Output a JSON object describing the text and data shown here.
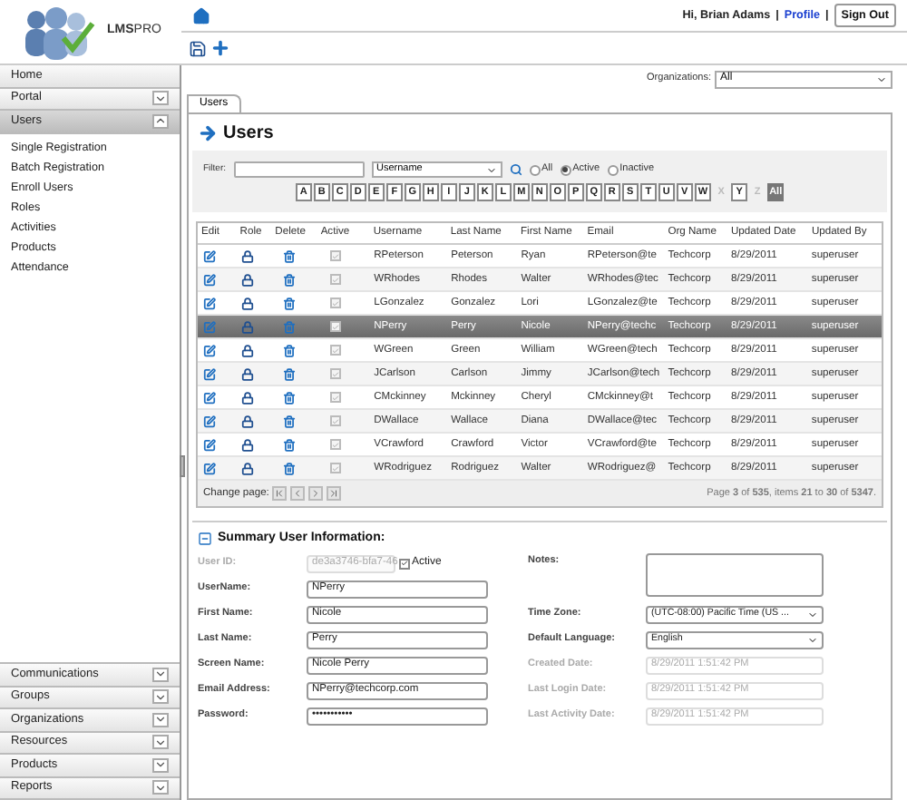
{
  "header": {
    "logo_text": "**LMS**PRO",
    "user_links": [
      {
        "kind": "text",
        "text": "Hi, Brian Adams"
      },
      {
        "kind": "sep",
        "text": "|"
      },
      {
        "kind": "link",
        "text": "Profile"
      },
      {
        "kind": "sep",
        "text": "|"
      },
      {
        "kind": "button",
        "text": "Sign Out"
      }
    ]
  },
  "sidebar": [
    {
      "label": "Home",
      "kind": "link"
    },
    {
      "label": "Portal",
      "kind": "group",
      "expanded": false
    },
    {
      "label": "Users",
      "kind": "group",
      "expanded": true,
      "children": [
        {
          "label": "Single Registration"
        },
        {
          "label": "Batch Registration"
        },
        {
          "label": "Enroll Users"
        },
        {
          "label": "Roles"
        },
        {
          "label": "Activities"
        },
        {
          "label": "Products"
        },
        {
          "label": "Attendance"
        }
      ]
    },
    {
      "label": "Communications",
      "kind": "group",
      "expanded": false
    },
    {
      "label": "Groups",
      "kind": "group",
      "expanded": false
    },
    {
      "label": "Organizations",
      "kind": "group",
      "expanded": false
    },
    {
      "label": "Resources",
      "kind": "group",
      "expanded": false
    },
    {
      "label": "Products",
      "kind": "group",
      "expanded": false
    },
    {
      "label": "Reports",
      "kind": "group",
      "expanded": false
    }
  ],
  "organizations": {
    "label": "Organizations:",
    "value": "All"
  },
  "tabs": [
    {
      "label": "Users",
      "selected": true
    }
  ],
  "page_title": "Users",
  "filter": {
    "label": "Filter:",
    "field_select": "Username",
    "radios": [
      {
        "label": "All",
        "selected": false
      },
      {
        "label": "Active",
        "selected": true
      },
      {
        "label": "Inactive",
        "selected": false
      }
    ],
    "letters": [
      {
        "label": "A",
        "disabled": false,
        "selected": false
      },
      {
        "label": "B",
        "disabled": false,
        "selected": false
      },
      {
        "label": "C",
        "disabled": false,
        "selected": false
      },
      {
        "label": "D",
        "disabled": false,
        "selected": false
      },
      {
        "label": "E",
        "disabled": false,
        "selected": false
      },
      {
        "label": "F",
        "disabled": false,
        "selected": false
      },
      {
        "label": "G",
        "disabled": false,
        "selected": false
      },
      {
        "label": "H",
        "disabled": false,
        "selected": false
      },
      {
        "label": "I",
        "disabled": false,
        "selected": false
      },
      {
        "label": "J",
        "disabled": false,
        "selected": false
      },
      {
        "label": "K",
        "disabled": false,
        "selected": false
      },
      {
        "label": "L",
        "disabled": false,
        "selected": false
      },
      {
        "label": "M",
        "disabled": false,
        "selected": false
      },
      {
        "label": "N",
        "disabled": false,
        "selected": false
      },
      {
        "label": "O",
        "disabled": false,
        "selected": false
      },
      {
        "label": "P",
        "disabled": false,
        "selected": false
      },
      {
        "label": "Q",
        "disabled": false,
        "selected": false
      },
      {
        "label": "R",
        "disabled": false,
        "selected": false
      },
      {
        "label": "S",
        "disabled": false,
        "selected": false
      },
      {
        "label": "T",
        "disabled": false,
        "selected": false
      },
      {
        "label": "U",
        "disabled": false,
        "selected": false
      },
      {
        "label": "V",
        "disabled": false,
        "selected": false
      },
      {
        "label": "W",
        "disabled": false,
        "selected": false
      },
      {
        "label": "X",
        "disabled": true,
        "selected": false
      },
      {
        "label": "Y",
        "disabled": false,
        "selected": false
      },
      {
        "label": "Z",
        "disabled": true,
        "selected": false
      },
      {
        "label": "All",
        "disabled": false,
        "selected": true
      }
    ]
  },
  "table": {
    "columns": [
      "Edit",
      "Role",
      "Delete",
      "Active",
      "Username",
      "Last Name",
      "First Name",
      "Email",
      "Org Name",
      "Updated Date",
      "Updated By"
    ],
    "rows": [
      {
        "username": "RPeterson",
        "last": "Peterson",
        "first": "Ryan",
        "email": "RPeterson@te",
        "org": "Techcorp",
        "date": "8/29/2011",
        "by": "superuser",
        "active": true,
        "selected": false
      },
      {
        "username": "WRhodes",
        "last": "Rhodes",
        "first": "Walter",
        "email": "WRhodes@tec",
        "org": "Techcorp",
        "date": "8/29/2011",
        "by": "superuser",
        "active": true,
        "selected": false
      },
      {
        "username": "LGonzalez",
        "last": "Gonzalez",
        "first": "Lori",
        "email": "LGonzalez@te",
        "org": "Techcorp",
        "date": "8/29/2011",
        "by": "superuser",
        "active": true,
        "selected": false
      },
      {
        "username": "NPerry",
        "last": "Perry",
        "first": "Nicole",
        "email": "NPerry@techc",
        "org": "Techcorp",
        "date": "8/29/2011",
        "by": "superuser",
        "active": true,
        "selected": true
      },
      {
        "username": "WGreen",
        "last": "Green",
        "first": "William",
        "email": "WGreen@tech",
        "org": "Techcorp",
        "date": "8/29/2011",
        "by": "superuser",
        "active": true,
        "selected": false
      },
      {
        "username": "JCarlson",
        "last": "Carlson",
        "first": "Jimmy",
        "email": "JCarlson@tech",
        "org": "Techcorp",
        "date": "8/29/2011",
        "by": "superuser",
        "active": true,
        "selected": false
      },
      {
        "username": "CMckinney",
        "last": "Mckinney",
        "first": "Cheryl",
        "email": "CMckinney@t",
        "org": "Techcorp",
        "date": "8/29/2011",
        "by": "superuser",
        "active": true,
        "selected": false
      },
      {
        "username": "DWallace",
        "last": "Wallace",
        "first": "Diana",
        "email": "DWallace@tec",
        "org": "Techcorp",
        "date": "8/29/2011",
        "by": "superuser",
        "active": true,
        "selected": false
      },
      {
        "username": "VCrawford",
        "last": "Crawford",
        "first": "Victor",
        "email": "VCrawford@te",
        "org": "Techcorp",
        "date": "8/29/2011",
        "by": "superuser",
        "active": true,
        "selected": false
      },
      {
        "username": "WRodriguez",
        "last": "Rodriguez",
        "first": "Walter",
        "email": "WRodriguez@",
        "org": "Techcorp",
        "date": "8/29/2011",
        "by": "superuser",
        "active": true,
        "selected": false
      }
    ],
    "pager": {
      "label": "Change page:",
      "summary": "Page **3** of **535**, items **21** to **30** of **5347**."
    }
  },
  "summary": {
    "title": "Summary User Information:",
    "left": [
      {
        "label": "User ID:",
        "value": "de3a3746-bfa7-46",
        "disabled": true,
        "checkbox": {
          "label": "Active",
          "checked": true
        }
      },
      {
        "label": "UserName:",
        "value": "NPerry",
        "disabled": false
      },
      {
        "label": "First Name:",
        "value": "Nicole",
        "disabled": false
      },
      {
        "label": "Last Name:",
        "value": "Perry",
        "disabled": false
      },
      {
        "label": "Screen Name:",
        "value": "Nicole Perry",
        "disabled": false
      },
      {
        "label": "Email Address:",
        "value": "NPerry@techcorp.com",
        "disabled": false
      },
      {
        "label": "Password:",
        "value": "•••••••••••",
        "disabled": false
      }
    ],
    "right": [
      {
        "label": "Notes:",
        "kind": "textarea",
        "disabled": false
      },
      {
        "label": "Time Zone:",
        "kind": "select",
        "value": "(UTC-08:00) Pacific Time (US ...",
        "disabled": false
      },
      {
        "label": "Default Language:",
        "kind": "select",
        "value": "English",
        "disabled": false
      },
      {
        "label": "Created Date:",
        "kind": "text",
        "value": "8/29/2011 1:51:42 PM",
        "disabled": true
      },
      {
        "label": "Last Login Date:",
        "kind": "text",
        "value": "8/29/2011 1:51:42 PM",
        "disabled": true
      },
      {
        "label": "Last Activity Date:",
        "kind": "text",
        "value": "8/29/2011 1:51:42 PM",
        "disabled": true
      }
    ]
  }
}
